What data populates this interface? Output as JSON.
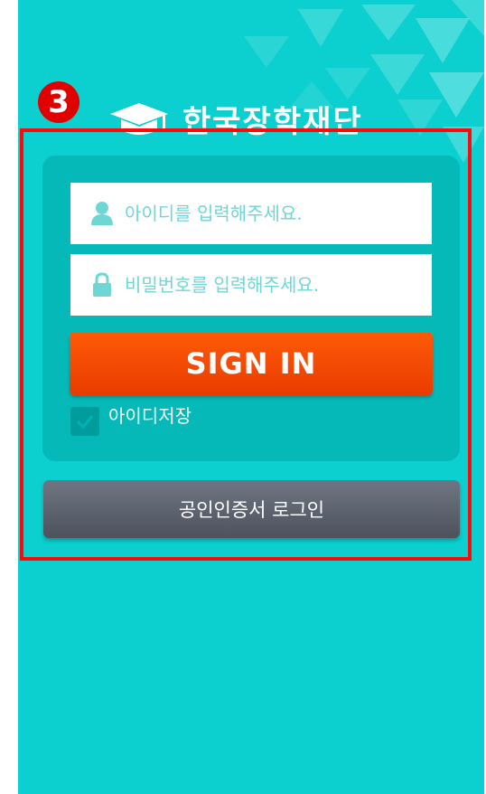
{
  "annotation": {
    "step_number": "3"
  },
  "header": {
    "org_name": "한국장학재단"
  },
  "login": {
    "id_placeholder": "아이디를 입력해주세요.",
    "password_placeholder": "비밀번호를 입력해주세요.",
    "signin_label": "SIGN IN",
    "remember_label": "아이디저장",
    "remember_checked": true
  },
  "certificate": {
    "label": "공인인증서 로그인"
  },
  "colors": {
    "background": "#0cd0d0",
    "panel": "#06b9b9",
    "signin": "#ff5000",
    "certificate": "#5a606b",
    "highlight": "#ff0a0a"
  }
}
